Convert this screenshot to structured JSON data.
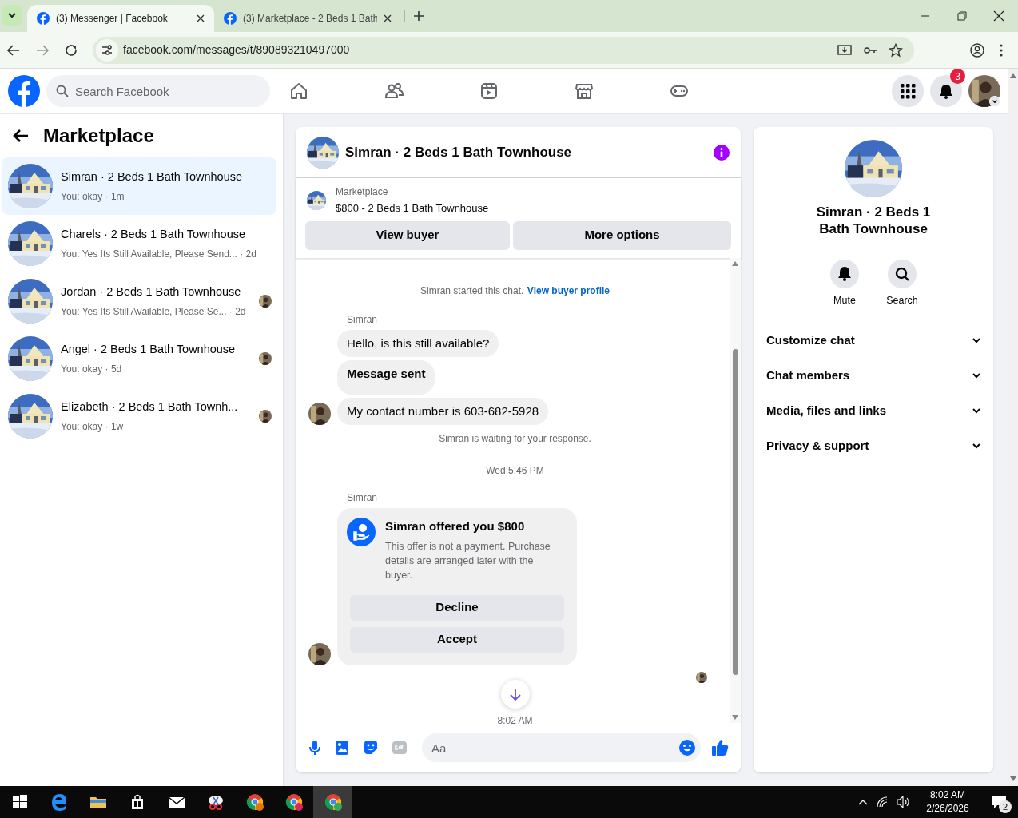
{
  "browser": {
    "tabs": [
      {
        "title": "(3) Messenger | Facebook",
        "selected": true
      },
      {
        "title": "(3) Marketplace - 2 Beds 1 Bath",
        "selected": false
      }
    ],
    "url": "facebook.com/messages/t/890893210497000"
  },
  "header": {
    "search_placeholder": "Search Facebook",
    "notification_count": "3"
  },
  "sidebar": {
    "title": "Marketplace",
    "conversations": [
      {
        "title": "Simran · 2 Beds 1 Bath Townhouse",
        "preview": "You: okay · 1m",
        "selected": true,
        "seen": false
      },
      {
        "title": "Charels · 2 Beds 1 Bath Townhouse",
        "preview": "You: Yes Its Still Available, Please Send... · 2d",
        "selected": false,
        "seen": false
      },
      {
        "title": "Jordan · 2 Beds 1 Bath Townhouse",
        "preview": "You: Yes Its Still Available, Please Se... · 2d",
        "selected": false,
        "seen": true
      },
      {
        "title": "Angel · 2 Beds 1 Bath Townhouse",
        "preview": "You: okay · 5d",
        "selected": false,
        "seen": true
      },
      {
        "title": "Elizabeth · 2 Beds 1 Bath Townh...",
        "preview": "You: okay · 1w",
        "selected": false,
        "seen": true
      }
    ]
  },
  "chat": {
    "title": "Simran · 2 Beds 1 Bath Townhouse",
    "listing": {
      "label": "Marketplace",
      "title": "$800 - 2 Beds 1 Bath Townhouse"
    },
    "buttons": [
      "View buyer",
      "More options"
    ],
    "messages": [
      {
        "kind": "system",
        "text": "Simran started this chat.",
        "link": "View buyer profile"
      },
      {
        "kind": "sender",
        "text": "Simran"
      },
      {
        "kind": "bubble",
        "text": "Hello, is this still available?",
        "avatar": false
      },
      {
        "kind": "notice",
        "text": "Message sent",
        "avatar": false
      },
      {
        "kind": "bubble",
        "text": "My contact number is 603-682-5928",
        "avatar": true
      },
      {
        "kind": "system",
        "text": "Simran is waiting for your response."
      },
      {
        "kind": "time",
        "text": "Wed 5:46 PM"
      },
      {
        "kind": "sender",
        "text": "Simran"
      },
      {
        "kind": "offer",
        "title": "Simran offered you $800",
        "body": "This offer is not a payment. Purchase details are arranged later with the buyer.",
        "actions": [
          "Decline",
          "Accept"
        ],
        "avatar": true
      },
      {
        "kind": "seen"
      },
      {
        "kind": "time",
        "text": "8:02 AM"
      }
    ],
    "composer_placeholder": "Aa"
  },
  "details": {
    "title": "Simran · 2 Beds 1 Bath Townhouse",
    "actions": [
      {
        "kind": "mute",
        "label": "Mute"
      },
      {
        "kind": "search",
        "label": "Search"
      }
    ],
    "sections": [
      "Customize chat",
      "Chat members",
      "Media, files and links",
      "Privacy & support"
    ]
  },
  "taskbar": {
    "time": "8:02 AM",
    "date": "2/26/2026",
    "notification_count": "2"
  }
}
